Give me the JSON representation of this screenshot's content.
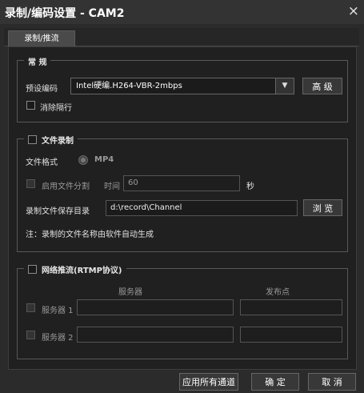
{
  "window": {
    "title": "录制/编码设置 - CAM2",
    "close_icon": "×"
  },
  "tabs": [
    {
      "label": "录制/推流"
    }
  ],
  "general": {
    "legend": "常 规",
    "preset_label": "预设编码",
    "preset_value": "Intel硬编.H264-VBR-2mbps",
    "advanced_button": "高 级",
    "deinterlace_label": "消除隔行"
  },
  "file_record": {
    "legend": "文件录制",
    "format_label": "文件格式",
    "format_value": "MP4",
    "split_label": "启用文件分割",
    "time_label": "时间",
    "time_value": "60",
    "time_unit": "秒",
    "dir_label": "录制文件保存目录",
    "dir_value": "d:\\record\\Channel",
    "browse_button": "浏 览",
    "note": "注：录制的文件名称由软件自动生成"
  },
  "rtmp": {
    "legend": "网络推流(RTMP协议)",
    "col_server": "服务器",
    "col_publish": "发布点",
    "rows": [
      {
        "label": "服务器 1",
        "server": "",
        "publish": ""
      },
      {
        "label": "服务器 2",
        "server": "",
        "publish": ""
      }
    ]
  },
  "footer": {
    "apply_all": "应用所有通道",
    "ok": "确 定",
    "cancel": "取 消"
  }
}
